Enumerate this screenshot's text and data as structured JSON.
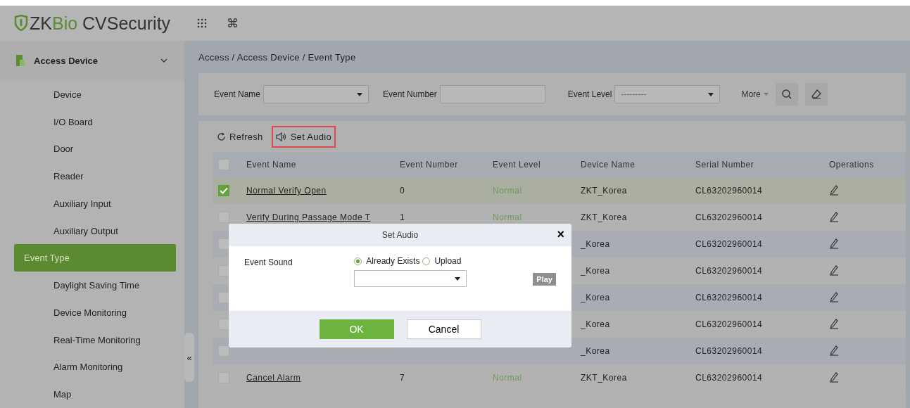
{
  "logo": {
    "prefix": "ZK",
    "accent": "Bio",
    "suffix": " CVSecurity"
  },
  "top_bar": {
    "shortcut_glyph": "⌘"
  },
  "sidebar": {
    "group": {
      "label": "Access Device",
      "expanded": true
    },
    "items": [
      {
        "label": "Device",
        "selected": false
      },
      {
        "label": "I/O Board",
        "selected": false
      },
      {
        "label": "Door",
        "selected": false
      },
      {
        "label": "Reader",
        "selected": false
      },
      {
        "label": "Auxiliary Input",
        "selected": false
      },
      {
        "label": "Auxiliary Output",
        "selected": false
      },
      {
        "label": "Event Type",
        "selected": true
      },
      {
        "label": "Daylight Saving Time",
        "selected": false
      },
      {
        "label": "Device Monitoring",
        "selected": false
      },
      {
        "label": "Real-Time Monitoring",
        "selected": false
      },
      {
        "label": "Alarm Monitoring",
        "selected": false
      },
      {
        "label": "Map",
        "selected": false
      }
    ],
    "collapse_glyph": "«"
  },
  "breadcrumb": "Access / Access Device / Event Type",
  "filters": {
    "event_name_label": "Event Name",
    "event_number_label": "Event Number",
    "event_level_label": "Event Level",
    "event_level_value": "---------",
    "more": "More"
  },
  "toolbar": [
    {
      "label": "Refresh",
      "kind": "refresh",
      "highlighted": false
    },
    {
      "label": "Set Audio",
      "kind": "audio",
      "highlighted": true
    }
  ],
  "table": {
    "all_checked": false,
    "columns": [
      "Event Name",
      "Event Number",
      "Event Level",
      "Device Name",
      "Serial Number",
      "Operations"
    ],
    "rows": [
      {
        "checked": true,
        "event_name": "Normal Verify Open",
        "event_number": "0",
        "event_level": "Normal",
        "device_name": "ZKT_Korea",
        "serial_number": "CL63202960014"
      },
      {
        "checked": false,
        "event_name": "Verify During Passage Mode T",
        "event_number": "1",
        "event_level": "Normal",
        "device_name": "ZKT_Korea",
        "serial_number": "CL63202960014"
      },
      {
        "checked": false,
        "device_name": "_Korea",
        "serial_number": "CL63202960014"
      },
      {
        "checked": false,
        "device_name": "_Korea",
        "serial_number": "CL63202960014"
      },
      {
        "checked": false,
        "device_name": "_Korea",
        "serial_number": "CL63202960014"
      },
      {
        "checked": false,
        "device_name": "_Korea",
        "serial_number": "CL63202960014"
      },
      {
        "checked": false,
        "device_name": "_Korea",
        "serial_number": "CL63202960014"
      },
      {
        "checked": false,
        "event_name": "Cancel Alarm",
        "event_number": "7",
        "event_level": "Normal",
        "device_name": "ZKT_Korea",
        "serial_number": "CL63202960014"
      }
    ]
  },
  "dialog": {
    "title": "Set Audio",
    "close": "×",
    "field_label": "Event Sound",
    "options": [
      {
        "label": "Already Exists",
        "selected": true
      },
      {
        "label": "Upload",
        "selected": false
      }
    ],
    "play": {
      "label": "Play",
      "disabled": true
    },
    "buttons": [
      {
        "label": "OK",
        "kind": "primary"
      },
      {
        "label": "Cancel",
        "kind": "secondary"
      }
    ]
  }
}
